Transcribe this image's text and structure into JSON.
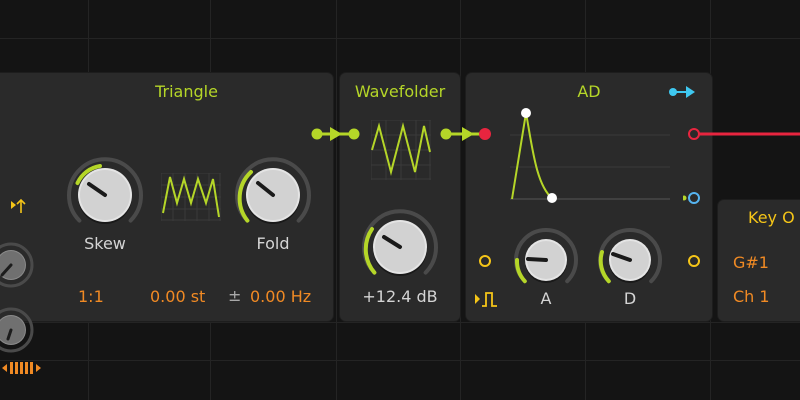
{
  "colors": {
    "accent_green": "#b5d628",
    "orange": "#f08a24",
    "yellow": "#f5c518",
    "red": "#e8253f",
    "blue": "#56b4f0",
    "cyan": "#3fc8f0",
    "panel_bg": "#2a2a2a",
    "canvas_bg": "#141414"
  },
  "triangle": {
    "title": "Triangle",
    "skew_label": "Skew",
    "fold_label": "Fold",
    "ratio": "1:1",
    "pitch": "0.00 st",
    "pm_symbol": "±",
    "freq": "0.00 Hz"
  },
  "wavefolder": {
    "title": "Wavefolder",
    "gain": "+12.4 dB"
  },
  "ad": {
    "title": "AD",
    "attack_label": "A",
    "decay_label": "D"
  },
  "key_on": {
    "title": "Key O",
    "note": "G#1",
    "channel": "Ch 1"
  }
}
